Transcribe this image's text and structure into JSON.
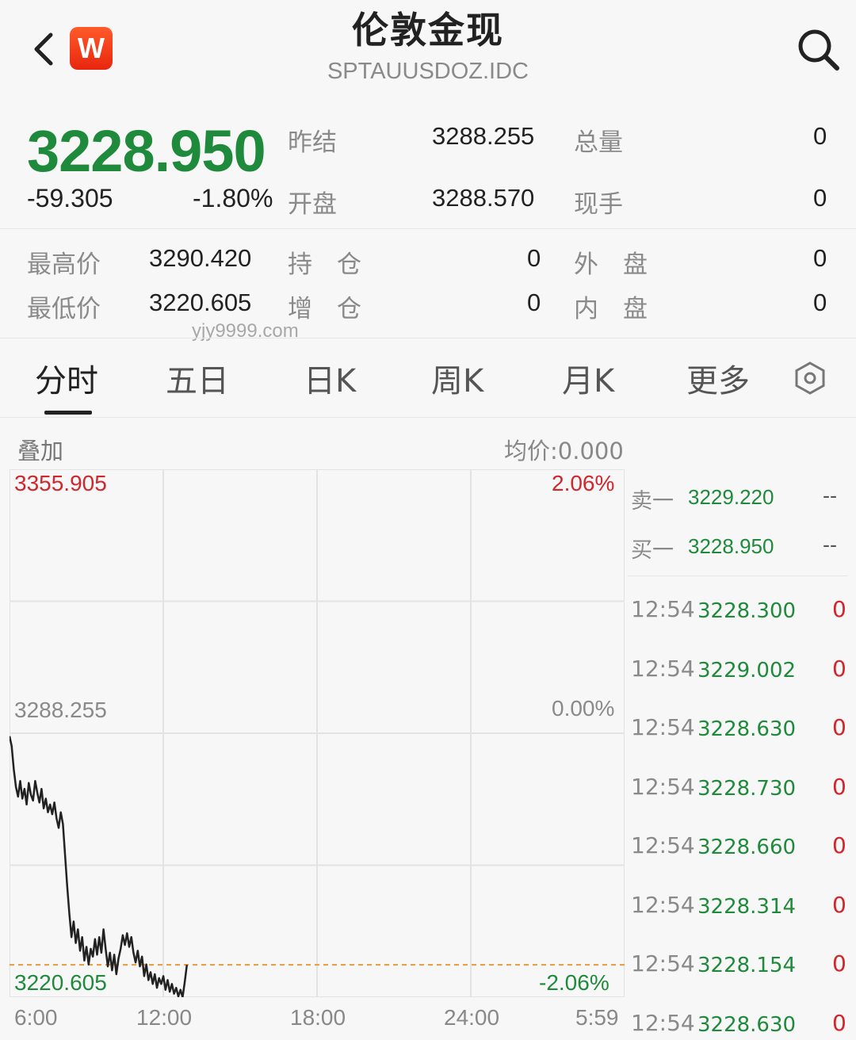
{
  "header": {
    "title": "伦敦金现",
    "subtitle": "SPTAUUSDOZ.IDC",
    "logo_letter": "W"
  },
  "quote": {
    "price": "3228.950",
    "change": "-59.305",
    "change_pct": "-1.80%",
    "prev_close_label": "昨结",
    "prev_close": "3288.255",
    "open_label": "开盘",
    "open": "3288.570",
    "volume_label": "总量",
    "volume": "0",
    "current_hand_label": "现手",
    "current_hand": "0",
    "high_label": "最高价",
    "high": "3290.420",
    "low_label": "最低价",
    "low": "3220.605",
    "position_label": "持　仓",
    "position": "0",
    "pos_change_label": "增　仓",
    "pos_change": "0",
    "outer_label": "外　盘",
    "outer": "0",
    "inner_label": "内　盘",
    "inner": "0"
  },
  "watermark": "yjy9999.com",
  "tabs": [
    {
      "label": "分时",
      "active": true
    },
    {
      "label": "五日"
    },
    {
      "label": "日K"
    },
    {
      "label": "周K"
    },
    {
      "label": "月K"
    },
    {
      "label": "更多"
    }
  ],
  "chart_header": {
    "overlay_label": "叠加",
    "avg_price": "均价:0.000"
  },
  "chart_data": {
    "type": "line",
    "y_max_label": "3355.905",
    "y_mid_label": "3288.255",
    "y_min_label": "3220.605",
    "pct_max_label": "2.06%",
    "pct_mid_label": "0.00%",
    "pct_min_label": "-2.06%",
    "ylim": [
      3220.605,
      3355.905
    ],
    "reference": 3288.255,
    "x_ticks": [
      "6:00",
      "12:00",
      "18:00",
      "24:00",
      "5:59"
    ],
    "xlim_minutes": [
      0,
      1439
    ],
    "x_minutes": [
      0,
      5,
      10,
      15,
      20,
      25,
      30,
      35,
      40,
      45,
      50,
      55,
      60,
      65,
      70,
      75,
      80,
      85,
      90,
      95,
      100,
      105,
      110,
      115,
      120,
      125,
      130,
      135,
      140,
      145,
      150,
      155,
      160,
      165,
      170,
      175,
      180,
      185,
      190,
      195,
      200,
      205,
      210,
      215,
      220,
      225,
      230,
      235,
      240,
      245,
      250,
      255,
      260,
      265,
      270,
      275,
      280,
      285,
      290,
      295,
      300,
      305,
      310,
      315,
      320,
      325,
      330,
      335,
      340,
      345,
      350,
      355,
      360,
      365,
      370,
      375,
      380,
      385,
      390,
      395,
      400,
      405,
      410,
      415
    ],
    "values": [
      3287.5,
      3285.0,
      3279.0,
      3274.5,
      3272.0,
      3276.0,
      3271.5,
      3274.0,
      3270.0,
      3275.5,
      3272.5,
      3271.0,
      3276.0,
      3273.0,
      3270.5,
      3274.0,
      3269.0,
      3271.5,
      3268.0,
      3270.0,
      3267.5,
      3270.5,
      3266.5,
      3264.0,
      3268.0,
      3265.0,
      3257.0,
      3249.0,
      3242.0,
      3236.0,
      3240.0,
      3234.5,
      3238.0,
      3232.5,
      3236.0,
      3230.0,
      3233.5,
      3229.0,
      3233.0,
      3231.0,
      3235.5,
      3231.5,
      3236.0,
      3232.0,
      3238.0,
      3233.0,
      3228.5,
      3232.0,
      3227.5,
      3231.5,
      3226.5,
      3230.5,
      3233.0,
      3236.5,
      3234.0,
      3237.0,
      3233.5,
      3236.0,
      3232.0,
      3229.5,
      3232.5,
      3228.5,
      3231.0,
      3226.0,
      3229.0,
      3225.0,
      3227.0,
      3224.0,
      3226.5,
      3223.0,
      3225.5,
      3224.0,
      3226.0,
      3222.5,
      3225.0,
      3222.0,
      3224.0,
      3221.5,
      3223.0,
      3220.8,
      3222.5,
      3220.6,
      3224.5,
      3228.9
    ]
  },
  "order_book": {
    "ask_label": "卖一",
    "ask_price": "3229.220",
    "ask_vol": "--",
    "bid_label": "买一",
    "bid_price": "3228.950",
    "bid_vol": "--"
  },
  "ticks": [
    {
      "time": "12:54",
      "price": "3228.300",
      "vol": "0"
    },
    {
      "time": "12:54",
      "price": "3229.002",
      "vol": "0"
    },
    {
      "time": "12:54",
      "price": "3228.630",
      "vol": "0"
    },
    {
      "time": "12:54",
      "price": "3228.730",
      "vol": "0"
    },
    {
      "time": "12:54",
      "price": "3228.660",
      "vol": "0"
    },
    {
      "time": "12:54",
      "price": "3228.314",
      "vol": "0"
    },
    {
      "time": "12:54",
      "price": "3228.154",
      "vol": "0"
    },
    {
      "time": "12:54",
      "price": "3228.630",
      "vol": "0"
    }
  ],
  "colors": {
    "up": "#d1262b",
    "down": "#1f8a3b",
    "line": "#222222",
    "dash": "#e79a3c"
  }
}
